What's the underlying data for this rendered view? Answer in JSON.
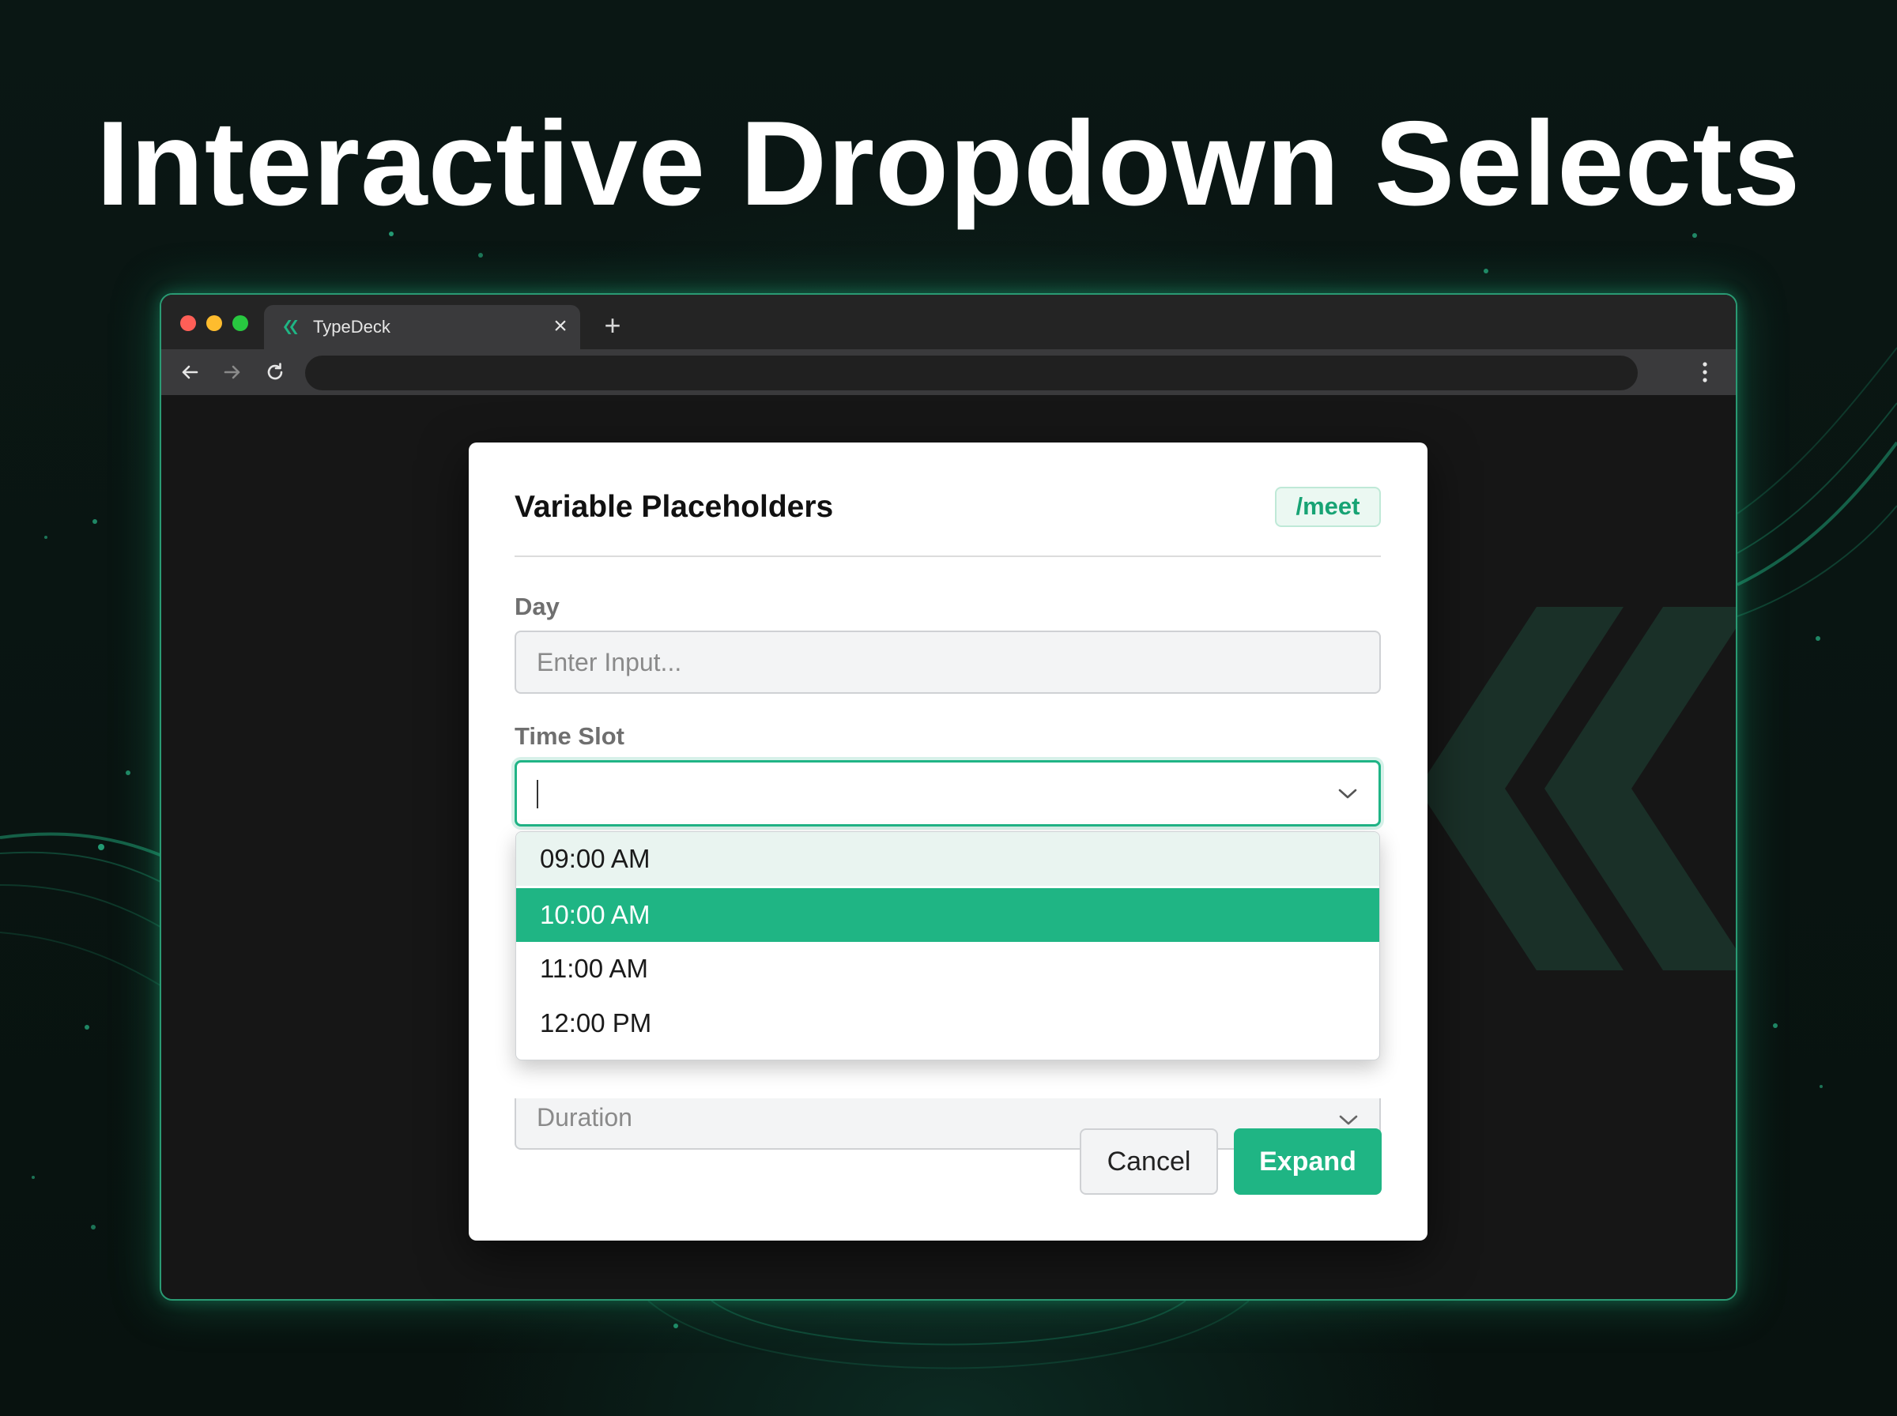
{
  "headline": "Interactive Dropdown Selects",
  "browser": {
    "tab_title": "TypeDeck",
    "tab_close": "×",
    "new_tab": "+"
  },
  "dialog": {
    "title": "Variable Placeholders",
    "shortcut": "/meet",
    "fields": {
      "day": {
        "label": "Day",
        "placeholder": "Enter Input..."
      },
      "time_slot": {
        "label": "Time Slot",
        "value": "",
        "options": [
          "09:00 AM",
          "10:00 AM",
          "11:00 AM",
          "12:00 PM"
        ],
        "highlighted_option": "09:00 AM",
        "selected_option": "10:00 AM"
      },
      "duration": {
        "placeholder": "Duration"
      }
    },
    "buttons": {
      "cancel": "Cancel",
      "expand": "Expand"
    }
  },
  "colors": {
    "accent": "#1fb584",
    "accent_light": "#e9f4f0",
    "badge_text": "#17a374",
    "background": "#08120f"
  },
  "icons": [
    "typedeck-logo-icon",
    "close-icon",
    "plus-icon",
    "back-arrow-icon",
    "forward-arrow-icon",
    "reload-icon",
    "more-vertical-icon",
    "chevron-down-icon"
  ]
}
